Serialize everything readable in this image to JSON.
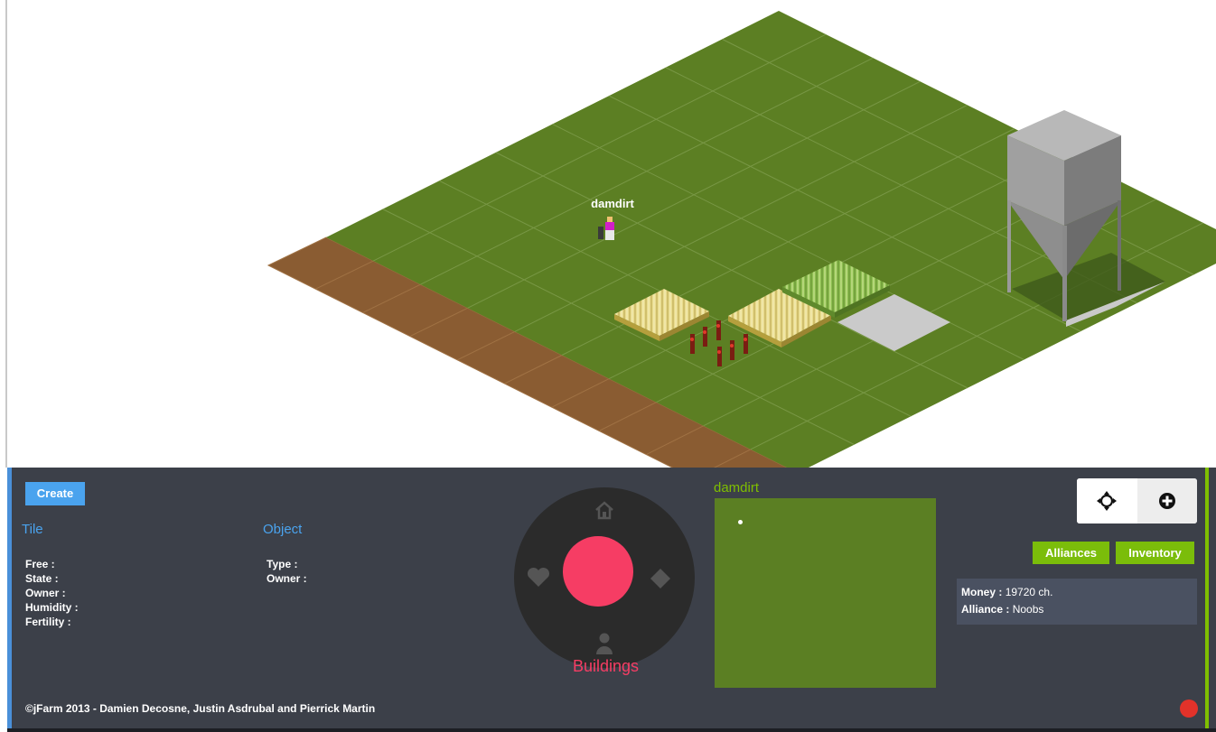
{
  "scene": {
    "player_name": "damdirt",
    "colors": {
      "grass": "#5c7f23",
      "path": "#8a5c32",
      "grid": "#7e9c4c",
      "slab": "#cacaca",
      "silo": "#9a9a9a"
    }
  },
  "hud": {
    "create_label": "Create",
    "tile": {
      "title": "Tile",
      "fields": [
        "Free :",
        "State :",
        "Owner :",
        "Humidity :",
        "Fertility :"
      ]
    },
    "object": {
      "title": "Object",
      "fields": [
        "Type :",
        "Owner :"
      ]
    },
    "wheel": {
      "label": "Buildings",
      "icons": [
        "home-icon",
        "heart-icon",
        "diamond-icon",
        "user-icon"
      ],
      "accent": "#f63d64"
    },
    "minimap": {
      "title": "damdirt"
    },
    "controls": {
      "center_icon": "crosshair-icon",
      "add_icon": "plus-circle-icon"
    },
    "alliances_label": "Alliances",
    "inventory_label": "Inventory",
    "stats": {
      "money_label": "Money :",
      "money_value": "19720 ch.",
      "alliance_label": "Alliance :",
      "alliance_value": "Noobs"
    },
    "footer": "©jFarm 2013 - Damien Decosne, Justin Asdrubal and Pierrick Martin"
  }
}
